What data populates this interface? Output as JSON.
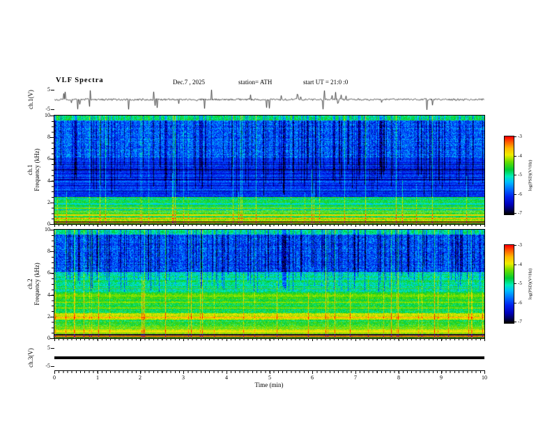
{
  "header": {
    "title": "VLF  Spectra",
    "date": "Dec.7  , 2025",
    "station": "station= ATH",
    "start_ut": "start UT  =  21:0  :0"
  },
  "xaxis": {
    "label": "Time  (min)",
    "min": 0,
    "max": 10,
    "ticks": [
      "0",
      "1",
      "2",
      "3",
      "4",
      "5",
      "6",
      "7",
      "8",
      "9",
      "10"
    ]
  },
  "panels": {
    "wave1": {
      "ylabel": "ch.1(V)",
      "ytick_top": "5",
      "ytick_bottom": "-5"
    },
    "spec1": {
      "ylabel_ch": "ch.1",
      "ylabel_freq": "Frequency  (kHz)",
      "yticks": [
        "10",
        "8",
        "6",
        "4",
        "2",
        "0"
      ]
    },
    "spec2": {
      "ylabel_ch": "ch.2",
      "ylabel_freq": "Frequency  (kHz)",
      "yticks": [
        "10",
        "8",
        "6",
        "4",
        "2",
        "0"
      ]
    },
    "ch3": {
      "ylabel": "ch.3(V)",
      "ytick_top": "5",
      "ytick_bottom": "-5"
    }
  },
  "colorbar": {
    "label": "log(PSD)(V²/Hz)",
    "ticks": [
      "-3",
      "-4",
      "-5",
      "-6",
      "-7"
    ],
    "range": [
      -7,
      -3
    ],
    "stops": [
      [
        -7,
        "#000000"
      ],
      [
        -6.8,
        "#000055"
      ],
      [
        -6.5,
        "#0000bb"
      ],
      [
        -6.1,
        "#0022ee"
      ],
      [
        -5.75,
        "#0066ff"
      ],
      [
        -5.35,
        "#00bbff"
      ],
      [
        -5.05,
        "#00eebb"
      ],
      [
        -4.7,
        "#00cc33"
      ],
      [
        -4.3,
        "#66dd00"
      ],
      [
        -3.95,
        "#eeee00"
      ],
      [
        -3.6,
        "#ffbb00"
      ],
      [
        -3.3,
        "#ff6600"
      ],
      [
        -3,
        "#ff0000"
      ]
    ]
  },
  "chart_data": [
    {
      "panel": "wave1",
      "type": "line",
      "title": "ch.1 raw signal",
      "xlabel": "Time (min)",
      "ylabel": "ch.1(V)",
      "xlim": [
        0,
        10
      ],
      "ylim": [
        -5,
        5
      ],
      "seed": 40,
      "noise_v": 0.45,
      "spike_prob": 0.05,
      "spike_v": 4.0,
      "description": "Broadband noise trace near 0 V with impulsive sferic spikes to roughly ±4 V across the full 10 minutes"
    },
    {
      "panel": "spec1",
      "type": "heatmap",
      "title": "ch.1 spectrogram",
      "xlabel": "Time (min)",
      "ylabel": "ch.1 Frequency (kHz)",
      "zlabel": "log(PSD)(V²/Hz)",
      "xlim": [
        0,
        10
      ],
      "ylim": [
        0,
        10
      ],
      "zlim": [
        -7,
        -3
      ],
      "seed": 20257,
      "bands": [
        {
          "f": [
            0,
            0.25
          ],
          "psd": -6.9,
          "stripe": 0.05,
          "noise": 0.1
        },
        {
          "f": [
            0.25,
            0.62
          ],
          "psd": -4.15,
          "stripe": 0.3,
          "noise": 0.25
        },
        {
          "f": [
            0.62,
            1.25
          ],
          "psd": -4.55,
          "stripe": 0.45,
          "noise": 0.3
        },
        {
          "f": [
            1.25,
            2.5
          ],
          "psd": -4.95,
          "stripe": 0.4,
          "noise": 0.3
        },
        {
          "f": [
            2.5,
            4.6
          ],
          "psd": -5.95,
          "stripe": 0.35,
          "noise": 0.3
        },
        {
          "f": [
            4.6,
            6.1
          ],
          "psd": -6.1,
          "stripe": 0.3,
          "noise": 0.3
        },
        {
          "f": [
            6.1,
            9.55
          ],
          "psd": -5.75,
          "stripe": 0.15,
          "noise": 0.5
        },
        {
          "f": [
            9.55,
            10
          ],
          "psd": -4.8,
          "stripe": 0.1,
          "noise": 0.3
        }
      ],
      "lines": [
        {
          "f": 0.0,
          "psd": -4.3,
          "w": 0.04
        },
        {
          "f": 0.13,
          "psd": -3.6,
          "w": 0.04
        },
        {
          "f": 0.5,
          "psd": -3.5,
          "w": 0.04
        },
        {
          "f": 0.8,
          "psd": -3.8,
          "w": 0.04
        },
        {
          "f": 1.08,
          "psd": -4.1,
          "w": 0.04
        },
        {
          "f": 1.45,
          "psd": -4.3,
          "w": 0.04
        },
        {
          "f": 2.0,
          "psd": -4.5,
          "w": 0.04
        },
        {
          "f": 3.05,
          "psd": -6.6,
          "w": 0.04
        },
        {
          "f": 3.55,
          "psd": -6.5,
          "w": 0.04
        },
        {
          "f": 4.1,
          "psd": -6.6,
          "w": 0.04
        },
        {
          "f": 5.0,
          "psd": -6.7,
          "w": 0.05
        },
        {
          "f": 5.5,
          "psd": -6.6,
          "w": 0.04
        }
      ],
      "dark_streaks": {
        "prob": 0.3,
        "fmin": 2.4,
        "fjitter": 3.5,
        "depth": [
          0.35,
          1.0
        ]
      },
      "bright_streaks": {
        "prob": 0.06,
        "gain": [
          0.35,
          0.9
        ]
      },
      "description": "Dense sferic activity: dark-blue vertical dropouts above ~2.5 kHz on a blue background, green/yellow band structure and red-brown horizontal lines below ~1.2 kHz, black band 0-0.25 kHz"
    },
    {
      "panel": "spec2",
      "type": "heatmap",
      "title": "ch.2 spectrogram",
      "xlabel": "Time (min)",
      "ylabel": "ch.2 Frequency (kHz)",
      "zlabel": "log(PSD)(V²/Hz)",
      "xlim": [
        0,
        10
      ],
      "ylim": [
        0,
        10
      ],
      "zlim": [
        -7,
        -3
      ],
      "seed": 77031,
      "bands": [
        {
          "f": [
            0,
            0.35
          ],
          "psd": -6.9,
          "stripe": 0.05,
          "noise": 0.1
        },
        {
          "f": [
            0.35,
            0.85
          ],
          "psd": -4.2,
          "stripe": 0.3,
          "noise": 0.25
        },
        {
          "f": [
            0.85,
            1.7
          ],
          "psd": -4.6,
          "stripe": 0.35,
          "noise": 0.3
        },
        {
          "f": [
            1.7,
            2.3
          ],
          "psd": -4.1,
          "stripe": 0.35,
          "noise": 0.3
        },
        {
          "f": [
            2.3,
            4.2
          ],
          "psd": -4.65,
          "stripe": 0.3,
          "noise": 0.3
        },
        {
          "f": [
            4.2,
            6.1
          ],
          "psd": -5.0,
          "stripe": 0.2,
          "noise": 0.35
        },
        {
          "f": [
            6.1,
            9.6
          ],
          "psd": -5.85,
          "stripe": 0.12,
          "noise": 0.5
        },
        {
          "f": [
            9.6,
            10
          ],
          "psd": -4.9,
          "stripe": 0.1,
          "noise": 0.3
        }
      ],
      "lines": [
        {
          "f": 0.0,
          "psd": -4.3,
          "w": 0.04
        },
        {
          "f": 0.16,
          "psd": -3.5,
          "w": 0.04
        },
        {
          "f": 0.55,
          "psd": -3.9,
          "w": 0.04
        },
        {
          "f": 1.0,
          "psd": -4.2,
          "w": 0.04
        },
        {
          "f": 1.9,
          "psd": -3.6,
          "w": 0.05
        },
        {
          "f": 2.2,
          "psd": -3.9,
          "w": 0.04
        },
        {
          "f": 2.75,
          "psd": -4.15,
          "w": 0.04
        },
        {
          "f": 3.3,
          "psd": -4.2,
          "w": 0.04
        },
        {
          "f": 3.9,
          "psd": -4.25,
          "w": 0.04
        },
        {
          "f": 4.6,
          "psd": -4.5,
          "w": 0.04
        },
        {
          "f": 5.3,
          "psd": -4.6,
          "w": 0.04
        }
      ],
      "dark_streaks": {
        "prob": 0.28,
        "fmin": 4.2,
        "fjitter": 2.5,
        "depth": [
          0.35,
          1.0
        ]
      },
      "bright_streaks": {
        "prob": 0.06,
        "gain": [
          0.35,
          0.9
        ]
      },
      "description": "Green background below ~6 kHz with yellow/red horizontal bands near 2 kHz, blue with vertical sferic dropouts above 6 kHz, black band 0-0.35 kHz"
    },
    {
      "panel": "ch3",
      "type": "line",
      "title": "ch.3 raw signal",
      "xlabel": "Time (min)",
      "ylabel": "ch.3(V)",
      "xlim": [
        0,
        10
      ],
      "ylim": [
        -5,
        5
      ],
      "value": 0,
      "description": "Flat constant trace at ~0 V drawn as a thick black line (channel off / no signal)"
    }
  ]
}
